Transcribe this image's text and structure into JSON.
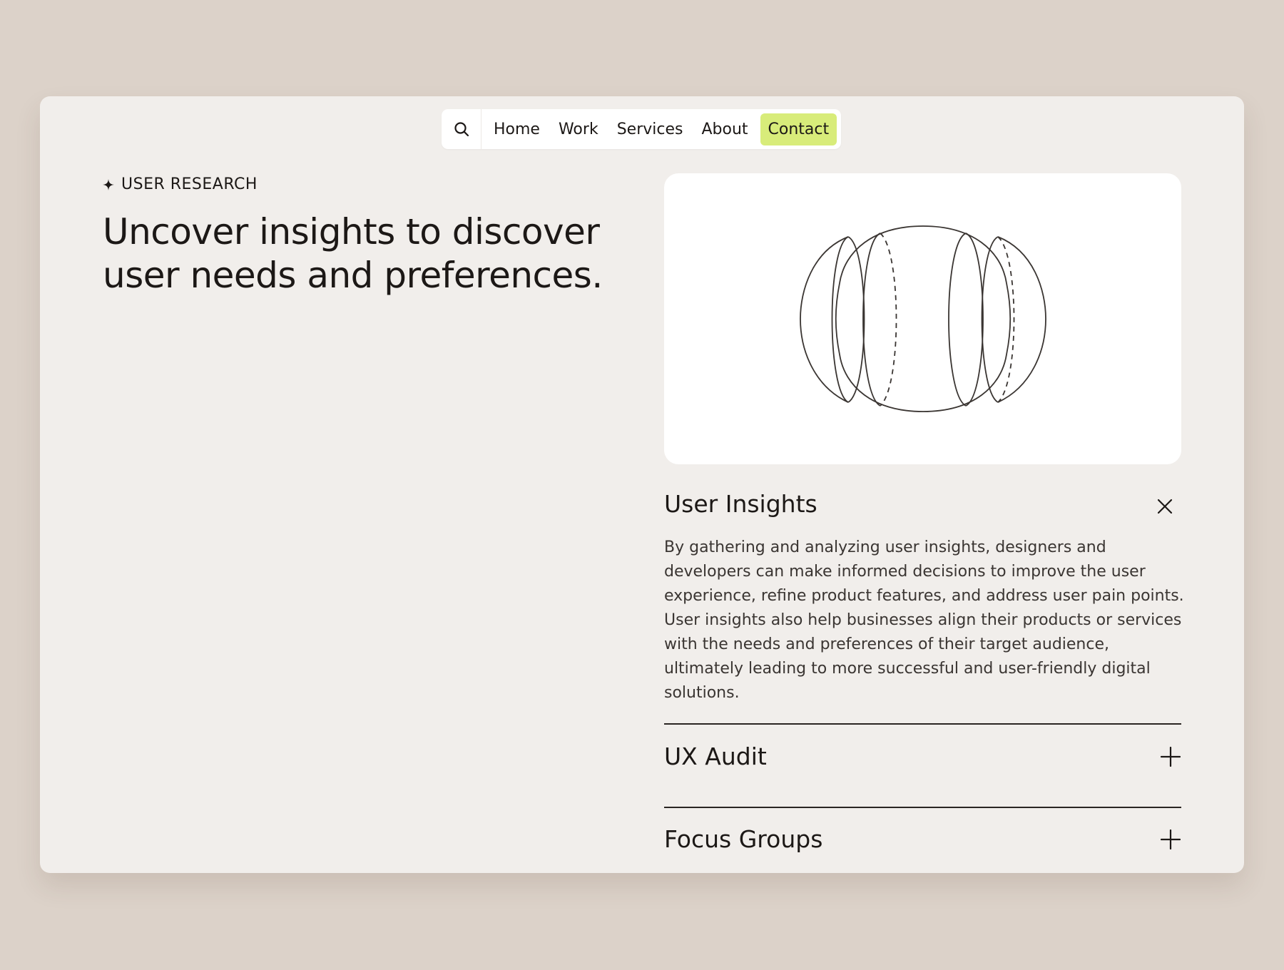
{
  "nav": {
    "search_icon": "search-icon",
    "items": [
      {
        "label": "Home"
      },
      {
        "label": "Work"
      },
      {
        "label": "Services"
      },
      {
        "label": "About"
      }
    ],
    "cta_label": "Contact",
    "cta_color": "#d8ec7a"
  },
  "hero": {
    "eyebrow_icon": "sparkle-icon",
    "eyebrow": "USER RESEARCH",
    "headline": "Uncover insights to discover user needs and preferences."
  },
  "accordion": {
    "open": {
      "title": "User Insights",
      "close_icon": "close-icon",
      "body": "By gathering and analyzing user insights, designers and developers can make informed decisions to improve the user experience, refine product features, and address user pain points. User insights also help businesses align their products or services with the needs and preferences of their target audience, ultimately leading to more successful and user-friendly digital solutions."
    },
    "items": [
      {
        "label": "UX Audit",
        "icon": "plus-icon"
      },
      {
        "label": "Focus Groups",
        "icon": "plus-icon"
      }
    ]
  },
  "colors": {
    "background": "#dcd2c9",
    "card": "#f1eeeb",
    "text": "#1c1816"
  }
}
